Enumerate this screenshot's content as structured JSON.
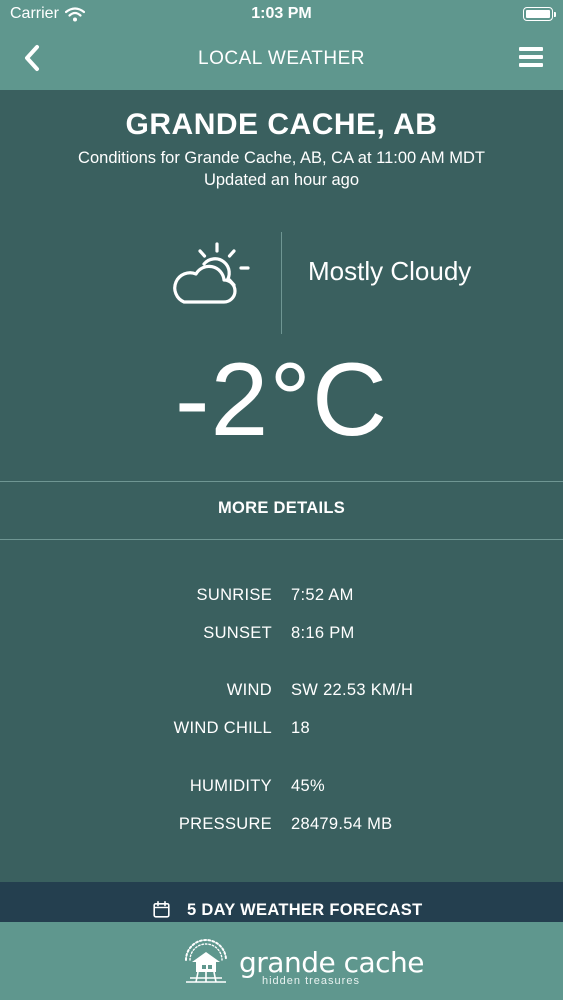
{
  "status": {
    "carrier": "Carrier",
    "time": "1:03 PM"
  },
  "nav": {
    "title": "LOCAL WEATHER"
  },
  "location": {
    "city": "GRANDE CACHE, AB",
    "conditions_line": "Conditions for Grande Cache, AB, CA at 11:00 AM MDT",
    "updated": "Updated an hour ago"
  },
  "current": {
    "icon": "partly-cloudy-icon",
    "condition": "Mostly Cloudy",
    "temperature": "-2°C"
  },
  "more_details_label": "MORE DETAILS",
  "details": [
    {
      "label": "SUNRISE",
      "value": "7:52 AM"
    },
    {
      "label": "SUNSET",
      "value": "8:16 PM"
    },
    {
      "label": "WIND",
      "value": "SW 22.53 KM/H"
    },
    {
      "label": "WIND CHILL",
      "value": "18"
    },
    {
      "label": "HUMIDITY",
      "value": "45%"
    },
    {
      "label": "PRESSURE",
      "value": "28479.54 MB"
    }
  ],
  "forecast": {
    "label": "5 DAY WEATHER FORECAST",
    "icon": "calendar-icon"
  },
  "footer": {
    "brand": "grande cache",
    "tagline": "hidden treasures"
  },
  "colors": {
    "header": "#5f978e",
    "background": "#3a605f",
    "forecast_bar": "#243f4f",
    "text": "#ffffff"
  }
}
